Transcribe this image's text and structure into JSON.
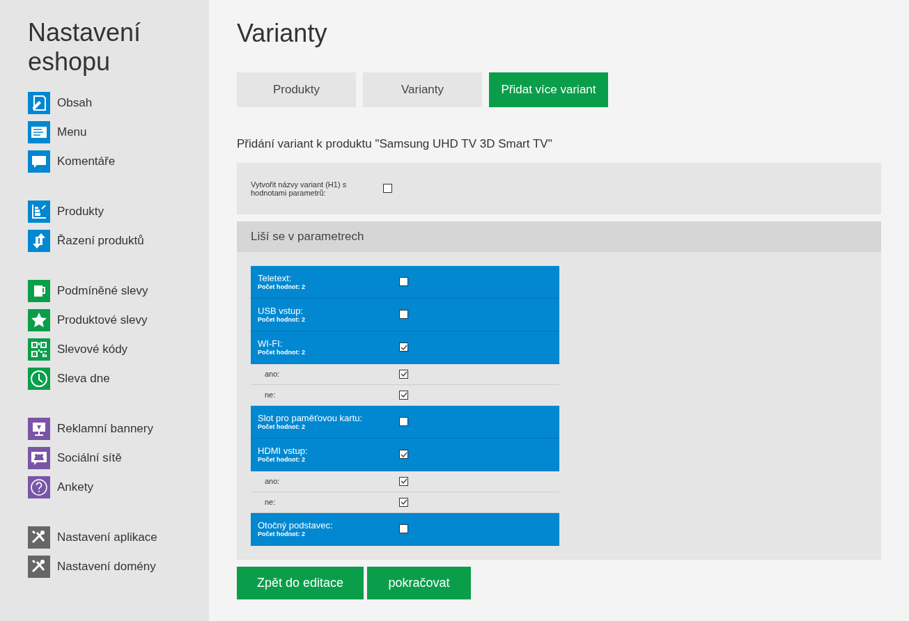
{
  "sidebar": {
    "title": "Nastavení eshopu",
    "groups": [
      {
        "color": "#0288d1",
        "items": [
          {
            "label": "Obsah"
          },
          {
            "label": "Menu"
          },
          {
            "label": "Komentáře"
          }
        ]
      },
      {
        "color": "#0288d1",
        "items": [
          {
            "label": "Produkty"
          },
          {
            "label": "Řazení produktů"
          }
        ]
      },
      {
        "color": "#0a9e4a",
        "items": [
          {
            "label": "Podmíněné slevy"
          },
          {
            "label": "Produktové slevy"
          },
          {
            "label": "Slevové kódy"
          },
          {
            "label": "Sleva dne"
          }
        ]
      },
      {
        "color": "#7a55a6",
        "items": [
          {
            "label": "Reklamní bannery"
          },
          {
            "label": "Sociální sítě"
          },
          {
            "label": "Ankety"
          }
        ]
      },
      {
        "color": "#666666",
        "items": [
          {
            "label": "Nastavení aplikace"
          },
          {
            "label": "Nastavení domény"
          }
        ]
      }
    ]
  },
  "main": {
    "title": "Varianty",
    "tabs": [
      {
        "label": "Produkty",
        "selected": false
      },
      {
        "label": "Varianty",
        "selected": false
      },
      {
        "label": "Přidat více variant",
        "selected": true
      }
    ],
    "subtitle": "Přidání variant k produktu \"Samsung UHD TV 3D Smart TV\"",
    "option": {
      "label": "Vytvořit názvy variant (H1) s hodnotami parametrů:",
      "checked": false
    },
    "section_title": "Liší se v parametrech",
    "parameters": [
      {
        "name": "Teletext:",
        "count": "Počet hodnot: 2",
        "checked": false
      },
      {
        "name": "USB vstup:",
        "count": "Počet hodnot: 2",
        "checked": false
      },
      {
        "name": "WI-FI:",
        "count": "Počet hodnot: 2",
        "checked": true,
        "children": [
          {
            "name": "ano:",
            "checked": true
          },
          {
            "name": "ne:",
            "checked": true
          }
        ]
      },
      {
        "name": "Slot pro paměťovou kartu:",
        "count": "Počet hodnot: 2",
        "checked": false
      },
      {
        "name": "HDMI vstup:",
        "count": "Počet hodnot: 2",
        "checked": true,
        "children": [
          {
            "name": "ano:",
            "checked": true
          },
          {
            "name": "ne:",
            "checked": true
          }
        ]
      },
      {
        "name": "Otočný podstavec:",
        "count": "Počet hodnot: 2",
        "checked": false
      }
    ],
    "buttons": [
      "Zpět do editace",
      "pokračovat"
    ]
  }
}
